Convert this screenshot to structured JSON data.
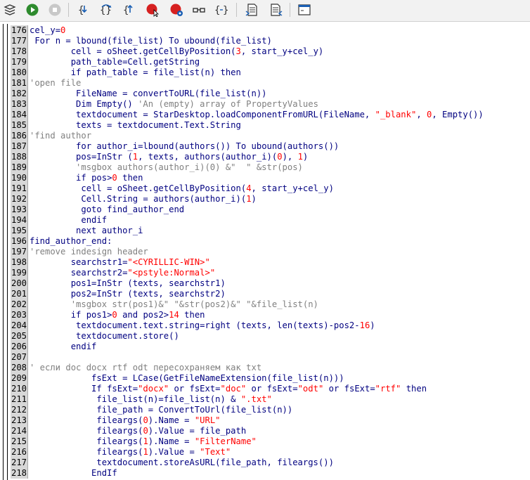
{
  "toolbar": {
    "buttons": [
      {
        "name": "select-module-button",
        "icon": "stack-icon"
      },
      {
        "name": "run-button",
        "icon": "play-icon"
      },
      {
        "name": "stop-button",
        "icon": "stop-icon"
      },
      {
        "name": "step-into-button",
        "icon": "step-into-icon"
      },
      {
        "name": "step-over-button",
        "icon": "step-over-icon"
      },
      {
        "name": "step-out-button",
        "icon": "step-out-icon"
      },
      {
        "name": "breakpoint-button",
        "icon": "breakpoint-icon"
      },
      {
        "name": "manage-breakpoints-button",
        "icon": "manage-breakpoints-icon"
      },
      {
        "name": "watch-button",
        "icon": "glasses-icon"
      },
      {
        "name": "find-parentheses-button",
        "icon": "braces-icon"
      },
      {
        "name": "insert-text-button",
        "icon": "document-icon"
      },
      {
        "name": "save-source-button",
        "icon": "save-document-icon"
      },
      {
        "name": "dialog-button",
        "icon": "window-icon"
      }
    ]
  },
  "editor": {
    "lines": [
      {
        "n": "176",
        "tokens": [
          [
            "t",
            "cel_y"
          ],
          [
            "o",
            "="
          ],
          [
            "n",
            "0"
          ]
        ]
      },
      {
        "n": "177",
        "tokens": [
          [
            "k",
            " For "
          ],
          [
            "t",
            "n = "
          ],
          [
            "t",
            "lbound(file_list) "
          ],
          [
            "k",
            "To "
          ],
          [
            "t",
            "ubound(file_list)"
          ]
        ]
      },
      {
        "n": "178",
        "tokens": [
          [
            "t",
            "        cell = oSheet.getCellByPosition("
          ],
          [
            "n",
            "3"
          ],
          [
            "t",
            ", start_y+cel_y)"
          ]
        ]
      },
      {
        "n": "179",
        "tokens": [
          [
            "t",
            "        path_table=Cell.getString"
          ]
        ]
      },
      {
        "n": "180",
        "tokens": [
          [
            "k",
            "        if "
          ],
          [
            "t",
            "path_table = file_list(n) "
          ],
          [
            "k",
            "then"
          ]
        ]
      },
      {
        "n": "181",
        "tokens": [
          [
            "c",
            "'open file"
          ]
        ]
      },
      {
        "n": "182",
        "tokens": [
          [
            "t",
            "         FileName = convertToURL(file_list(n))"
          ]
        ]
      },
      {
        "n": "183",
        "tokens": [
          [
            "k",
            "         Dim "
          ],
          [
            "t",
            "Empty() "
          ],
          [
            "c",
            "'An (empty) array of PropertyValues"
          ]
        ]
      },
      {
        "n": "184",
        "tokens": [
          [
            "t",
            "         textdocument = StarDesktop.loadComponentFromURL(FileName, "
          ],
          [
            "s",
            "\"_blank\""
          ],
          [
            "t",
            ", "
          ],
          [
            "n",
            "0"
          ],
          [
            "t",
            ", Empty())"
          ]
        ]
      },
      {
        "n": "185",
        "tokens": [
          [
            "t",
            "         texts = textdocument.Text.String"
          ]
        ]
      },
      {
        "n": "186",
        "tokens": [
          [
            "c",
            "'find author"
          ]
        ]
      },
      {
        "n": "187",
        "tokens": [
          [
            "k",
            "         for "
          ],
          [
            "t",
            "author_i=lbound(authors()) "
          ],
          [
            "k",
            "To "
          ],
          [
            "t",
            "ubound(authors())"
          ]
        ]
      },
      {
        "n": "188",
        "tokens": [
          [
            "t",
            "         pos=InStr ("
          ],
          [
            "n",
            "1"
          ],
          [
            "t",
            ", texts, authors(author_i)("
          ],
          [
            "n",
            "0"
          ],
          [
            "t",
            "), "
          ],
          [
            "n",
            "1"
          ],
          [
            "t",
            ")"
          ]
        ]
      },
      {
        "n": "189",
        "tokens": [
          [
            "c",
            "         'msgbox authors(author_i)(0) &\"  \" &str(pos)"
          ]
        ]
      },
      {
        "n": "190",
        "tokens": [
          [
            "k",
            "         if "
          ],
          [
            "t",
            "pos>"
          ],
          [
            "n",
            "0"
          ],
          [
            "k",
            " then"
          ]
        ]
      },
      {
        "n": "191",
        "tokens": [
          [
            "t",
            "          cell = oSheet.getCellByPosition("
          ],
          [
            "n",
            "4"
          ],
          [
            "t",
            ", start_y+cel_y)"
          ]
        ]
      },
      {
        "n": "192",
        "tokens": [
          [
            "t",
            "          Cell.String = authors(author_i)("
          ],
          [
            "n",
            "1"
          ],
          [
            "t",
            ")"
          ]
        ]
      },
      {
        "n": "193",
        "tokens": [
          [
            "k",
            "          goto "
          ],
          [
            "t",
            "find_author_end"
          ]
        ]
      },
      {
        "n": "194",
        "tokens": [
          [
            "k",
            "          endif"
          ]
        ]
      },
      {
        "n": "195",
        "tokens": [
          [
            "k",
            "         next "
          ],
          [
            "t",
            "author_i"
          ]
        ]
      },
      {
        "n": "196",
        "tokens": [
          [
            "t",
            "find_author_end:"
          ]
        ]
      },
      {
        "n": "197",
        "tokens": [
          [
            "c",
            "'remove indesign header"
          ]
        ]
      },
      {
        "n": "198",
        "tokens": [
          [
            "t",
            "        searchstr1="
          ],
          [
            "s",
            "\"<CYRILLIC-WIN>\""
          ]
        ]
      },
      {
        "n": "199",
        "tokens": [
          [
            "t",
            "        searchstr2="
          ],
          [
            "s",
            "\"<pstyle:Normal>\""
          ]
        ]
      },
      {
        "n": "200",
        "tokens": [
          [
            "t",
            "        pos1=InStr (texts, searchstr1)"
          ]
        ]
      },
      {
        "n": "201",
        "tokens": [
          [
            "t",
            "        pos2=InStr (texts, searchstr2)"
          ]
        ]
      },
      {
        "n": "202",
        "tokens": [
          [
            "c",
            "        'msgbox str(pos1)&\" \"&str(pos2)&\" \"&file_list(n)"
          ]
        ]
      },
      {
        "n": "203",
        "tokens": [
          [
            "k",
            "        if "
          ],
          [
            "t",
            "pos1>"
          ],
          [
            "n",
            "0"
          ],
          [
            "k",
            " and "
          ],
          [
            "t",
            "pos2>"
          ],
          [
            "n",
            "14"
          ],
          [
            "k",
            " then"
          ]
        ]
      },
      {
        "n": "204",
        "tokens": [
          [
            "t",
            "         textdocument.text.string=right (texts, len(texts)-pos2-"
          ],
          [
            "n",
            "16"
          ],
          [
            "t",
            ")"
          ]
        ]
      },
      {
        "n": "205",
        "tokens": [
          [
            "t",
            "         textdocument.store()"
          ]
        ]
      },
      {
        "n": "206",
        "tokens": [
          [
            "k",
            "        endif"
          ]
        ]
      },
      {
        "n": "207",
        "tokens": [
          [
            "t",
            ""
          ]
        ]
      },
      {
        "n": "208",
        "tokens": [
          [
            "c",
            "' если doc docx rtf odt пересохраняем как txt"
          ]
        ]
      },
      {
        "n": "209",
        "tokens": [
          [
            "t",
            "            fsExt = LCase(GetFileNameExtension(file_list(n)))"
          ]
        ]
      },
      {
        "n": "210",
        "tokens": [
          [
            "k",
            "            If "
          ],
          [
            "t",
            "fsExt="
          ],
          [
            "s",
            "\"docx\""
          ],
          [
            "k",
            " or "
          ],
          [
            "t",
            "fsExt="
          ],
          [
            "s",
            "\"doc\""
          ],
          [
            "k",
            " or "
          ],
          [
            "t",
            "fsExt="
          ],
          [
            "s",
            "\"odt\""
          ],
          [
            "k",
            " or "
          ],
          [
            "t",
            "fsExt="
          ],
          [
            "s",
            "\"rtf\""
          ],
          [
            "k",
            " then"
          ]
        ]
      },
      {
        "n": "211",
        "tokens": [
          [
            "t",
            "             file_list(n)=file_list(n) & "
          ],
          [
            "s",
            "\".txt\""
          ]
        ]
      },
      {
        "n": "212",
        "tokens": [
          [
            "t",
            "             file_path = ConvertToUrl(file_list(n))"
          ]
        ]
      },
      {
        "n": "213",
        "tokens": [
          [
            "t",
            "             fileargs("
          ],
          [
            "n",
            "0"
          ],
          [
            "t",
            ").Name = "
          ],
          [
            "s",
            "\"URL\""
          ]
        ]
      },
      {
        "n": "214",
        "tokens": [
          [
            "t",
            "             fileargs("
          ],
          [
            "n",
            "0"
          ],
          [
            "t",
            ").Value = file_path"
          ]
        ]
      },
      {
        "n": "215",
        "tokens": [
          [
            "t",
            "             fileargs("
          ],
          [
            "n",
            "1"
          ],
          [
            "t",
            ").Name = "
          ],
          [
            "s",
            "\"FilterName\""
          ]
        ]
      },
      {
        "n": "216",
        "tokens": [
          [
            "t",
            "             fileargs("
          ],
          [
            "n",
            "1"
          ],
          [
            "t",
            ").Value = "
          ],
          [
            "s",
            "\"Text\""
          ]
        ]
      },
      {
        "n": "217",
        "tokens": [
          [
            "t",
            "             textdocument.storeAsURL(file_path, fileargs())"
          ]
        ]
      },
      {
        "n": "218",
        "tokens": [
          [
            "k",
            "            EndIf"
          ]
        ]
      }
    ]
  }
}
